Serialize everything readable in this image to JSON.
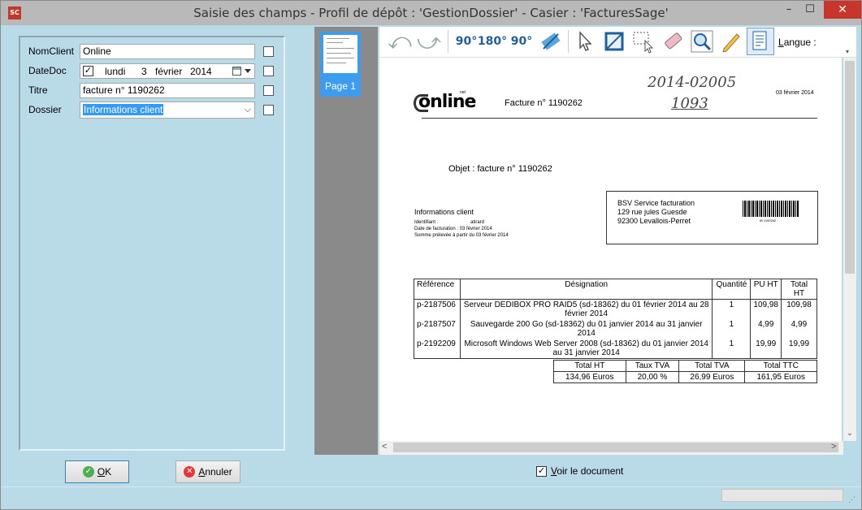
{
  "window": {
    "title": "Saisie des champs - Profil de dépôt : 'GestionDossier' - Casier : 'FacturesSage'",
    "app_icon": "SC",
    "minimize": "–",
    "maximize": "☐",
    "close": "✕"
  },
  "fields": [
    {
      "label": "NomClient",
      "value": "Online"
    },
    {
      "label": "DateDoc",
      "day_name": "lundi",
      "day": "3",
      "month": "février",
      "year": "2014",
      "checked_mark": "✓"
    },
    {
      "label": "Titre",
      "value": "facture n° 1190262"
    },
    {
      "label": "Dossier",
      "value": "Informations client",
      "arrow": "⌵"
    }
  ],
  "thumbnails": [
    {
      "label": "Page 1"
    }
  ],
  "toolbar": {
    "undo": "⤺",
    "redo": "⤻",
    "rot_90_ccw": "90°",
    "rot_180": "180°",
    "rot_90_cw": "90°",
    "langue_label": "Langue :",
    "langue_accel": "L",
    "langue_rest": "angue :"
  },
  "document": {
    "logo_text": "online",
    "logo_sub": "net",
    "invoice_title": "Facture n° 1190262",
    "date_top": "03 février 2014",
    "hand_line1": "2014-02005",
    "hand_line2": "1093",
    "object": "Objet : facture n° 1190262",
    "info_title": "Informations client",
    "info_id_label": "Identifiant :",
    "info_id_value": "atirard",
    "info_date": "Date de facturation : 03 février 2014",
    "info_somme": "Somme prélevée à partir du 03 février 2014",
    "addr_1": "BSV Service facturation",
    "addr_2": "129 rue jules Guesde",
    "addr_3": "92300 Levallois-Perret",
    "barcode_text": "IB 1190262",
    "table_headers": [
      "Référence",
      "Désignation",
      "Quantité",
      "PU HT",
      "Total HT"
    ],
    "table_rows": [
      {
        "ref": "p-2187506",
        "des": "Serveur DEDIBOX PRO RAID5 (sd-18362) du 01 février 2014 au 28 février 2014",
        "qty": "1",
        "pu": "109,98",
        "total": "109,98"
      },
      {
        "ref": "p-2187507",
        "des": "Sauvegarde 200 Go (sd-18362) du 01 janvier 2014 au 31 janvier 2014",
        "qty": "1",
        "pu": "4,99",
        "total": "4,99"
      },
      {
        "ref": "p-2192209",
        "des": "Microsoft Windows Web Server 2008 (sd-18362) du 01 janvier 2014 au 31 janvier 2014",
        "qty": "1",
        "pu": "19,99",
        "total": "19,99"
      }
    ],
    "totals_headers": [
      "Total HT",
      "Taux TVA",
      "Total TVA",
      "Total TTC"
    ],
    "totals_values": [
      "134,96 Euros",
      "20,00 %",
      "26,99 Euros",
      "161,95 Euros"
    ]
  },
  "buttons": {
    "ok_accel": "O",
    "ok_rest": "K",
    "ok_icon": "✓",
    "cancel_accel": "A",
    "cancel_rest": "nnuler",
    "cancel_icon": "✕"
  },
  "voir": {
    "accel": "V",
    "rest": "oir le document",
    "checked_mark": "✓"
  },
  "scroll": {
    "up": "▲",
    "down": "⌄",
    "left": "<",
    "right": ">"
  },
  "status": {
    "grip": "⋰"
  }
}
